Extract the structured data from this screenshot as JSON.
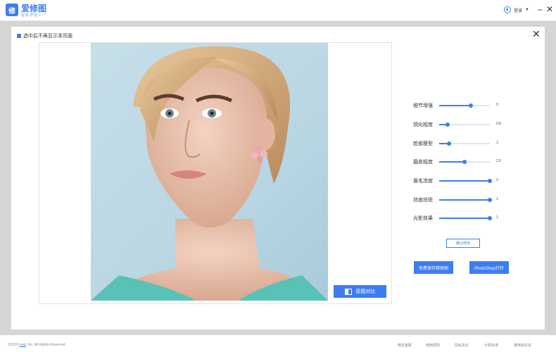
{
  "app": {
    "logo_text": "修",
    "brand": "爱修图",
    "slogan": "智能修图工厂"
  },
  "user": {
    "label": "登录",
    "caret": "▼"
  },
  "window": {
    "minimize": "–",
    "close": "✕"
  },
  "notice": {
    "label": "选中后不再显示本页面"
  },
  "dialog": {
    "close": "✕"
  },
  "compare_button": "原图对比",
  "sliders": [
    {
      "label": "细节增强",
      "value": "3",
      "level": 0.62
    },
    {
      "label": "锐化程度",
      "value": "0.8",
      "level": 0.16
    },
    {
      "label": "脸部瘦型",
      "value": "1",
      "level": 0.19
    },
    {
      "label": "磨皮程度",
      "value": "2.5",
      "level": 0.5
    },
    {
      "label": "眉毛浓度",
      "value": "1",
      "level": 1.0
    },
    {
      "label": "祛痘祛斑",
      "value": "1",
      "level": 1.0
    },
    {
      "label": "光影效果",
      "value": "1",
      "level": 1.0
    }
  ],
  "confirm_button": "确认修改",
  "save_button": "免费保存精修图",
  "photoshop_button": "PhotoShop打开",
  "footer": {
    "copyright_prefix": "©2019 ",
    "copyright_link": "Leqi",
    "copyright_suffix": ", Inc. All Rights Reserved",
    "links": [
      "微信客服",
      "使用帮助",
      "隐私协议",
      "计费标准",
      "推荐给好友"
    ]
  },
  "colors": {
    "accent": "#3c7df2",
    "backdrop": "#d5d5d5"
  }
}
